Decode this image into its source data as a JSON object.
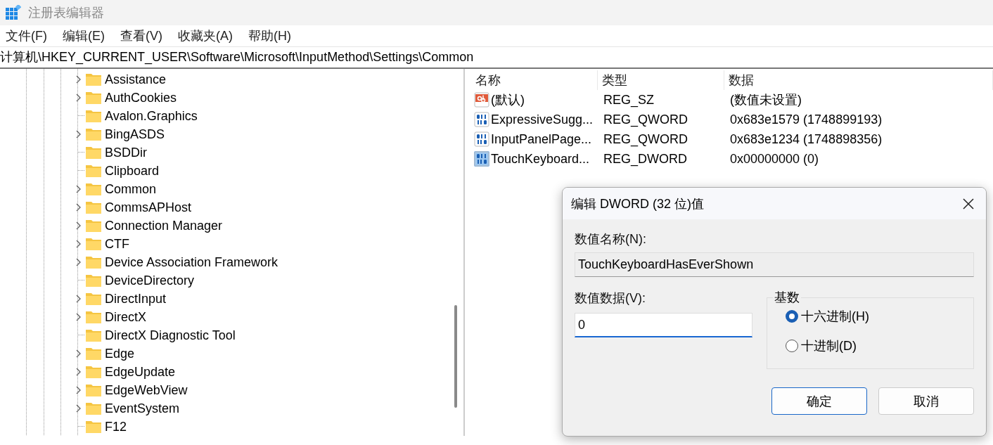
{
  "window": {
    "title": "注册表编辑器"
  },
  "menu": [
    "文件(F)",
    "编辑(E)",
    "查看(V)",
    "收藏夹(A)",
    "帮助(H)"
  ],
  "address": "计算机\\HKEY_CURRENT_USER\\Software\\Microsoft\\InputMethod\\Settings\\Common",
  "tree": {
    "items": [
      {
        "label": "Assistance",
        "expandable": true
      },
      {
        "label": "AuthCookies",
        "expandable": true
      },
      {
        "label": "Avalon.Graphics",
        "expandable": false
      },
      {
        "label": "BingASDS",
        "expandable": true
      },
      {
        "label": "BSDDir",
        "expandable": false
      },
      {
        "label": "Clipboard",
        "expandable": false
      },
      {
        "label": "Common",
        "expandable": true
      },
      {
        "label": "CommsAPHost",
        "expandable": true
      },
      {
        "label": "Connection Manager",
        "expandable": true
      },
      {
        "label": "CTF",
        "expandable": true
      },
      {
        "label": "Device Association Framework",
        "expandable": true
      },
      {
        "label": "DeviceDirectory",
        "expandable": false
      },
      {
        "label": "DirectInput",
        "expandable": true
      },
      {
        "label": "DirectX",
        "expandable": true
      },
      {
        "label": "DirectX Diagnostic Tool",
        "expandable": false
      },
      {
        "label": "Edge",
        "expandable": true
      },
      {
        "label": "EdgeUpdate",
        "expandable": true
      },
      {
        "label": "EdgeWebView",
        "expandable": true
      },
      {
        "label": "EventSystem",
        "expandable": true
      },
      {
        "label": "F12",
        "expandable": false
      }
    ]
  },
  "values": {
    "columns": [
      "名称",
      "类型",
      "数据"
    ],
    "rows": [
      {
        "kind": "string",
        "name": "(默认)",
        "type": "REG_SZ",
        "data": "(数值未设置)",
        "selected": false
      },
      {
        "kind": "binary",
        "name": "ExpressiveSugg...",
        "type": "REG_QWORD",
        "data": "0x683e1579 (1748899193)",
        "selected": false
      },
      {
        "kind": "binary",
        "name": "InputPanelPage...",
        "type": "REG_QWORD",
        "data": "0x683e1234 (1748898356)",
        "selected": false
      },
      {
        "kind": "binary",
        "name": "TouchKeyboard...",
        "type": "REG_DWORD",
        "data": "0x00000000 (0)",
        "selected": true
      }
    ]
  },
  "dialog": {
    "title": "编辑 DWORD (32 位)值",
    "name_label": "数值名称(N):",
    "name_value": "TouchKeyboardHasEverShown",
    "data_label": "数值数据(V):",
    "data_value": "0",
    "base_label": "基数",
    "base_options": [
      {
        "label": "十六进制(H)",
        "selected": true
      },
      {
        "label": "十进制(D)",
        "selected": false
      }
    ],
    "buttons": [
      {
        "label": "确定",
        "default": true
      },
      {
        "label": "取消",
        "default": false
      }
    ]
  }
}
